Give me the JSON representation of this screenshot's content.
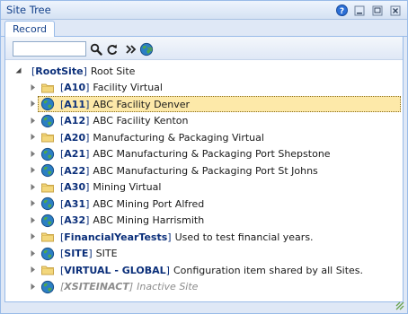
{
  "window": {
    "title": "Site Tree"
  },
  "tabs": [
    {
      "label": "Record"
    }
  ],
  "toolbar": {
    "search_value": ""
  },
  "tree": {
    "root": {
      "code": "RootSite",
      "desc": "Root Site"
    },
    "items": [
      {
        "code": "A10",
        "desc": "Facility Virtual",
        "icon": "folder-icon"
      },
      {
        "code": "A11",
        "desc": "ABC Facility Denver",
        "icon": "globe-icon",
        "selected": true
      },
      {
        "code": "A12",
        "desc": "ABC Facility Kenton",
        "icon": "globe-icon"
      },
      {
        "code": "A20",
        "desc": "Manufacturing & Packaging Virtual",
        "icon": "folder-icon"
      },
      {
        "code": "A21",
        "desc": "ABC Manufacturing & Packaging Port Shepstone",
        "icon": "globe-icon"
      },
      {
        "code": "A22",
        "desc": "ABC Manufacturing & Packaging Port St Johns",
        "icon": "globe-icon"
      },
      {
        "code": "A30",
        "desc": "Mining Virtual",
        "icon": "folder-icon"
      },
      {
        "code": "A31",
        "desc": "ABC Mining Port Alfred",
        "icon": "globe-icon"
      },
      {
        "code": "A32",
        "desc": "ABC Mining Harrismith",
        "icon": "globe-icon"
      },
      {
        "code": "FinancialYearTests",
        "desc": "Used to test financial years.",
        "icon": "folder-icon"
      },
      {
        "code": "SITE",
        "desc": "SITE",
        "icon": "globe-icon"
      },
      {
        "code": "VIRTUAL - GLOBAL",
        "desc": "Configuration item shared by all Sites.",
        "icon": "folder-icon"
      },
      {
        "code": "XSITEINACT",
        "desc": "Inactive Site",
        "icon": "globe-icon",
        "inactive": true
      }
    ]
  },
  "colors": {
    "accent": "#15428b",
    "selection": "#fde9a9",
    "border": "#99bbe8"
  }
}
